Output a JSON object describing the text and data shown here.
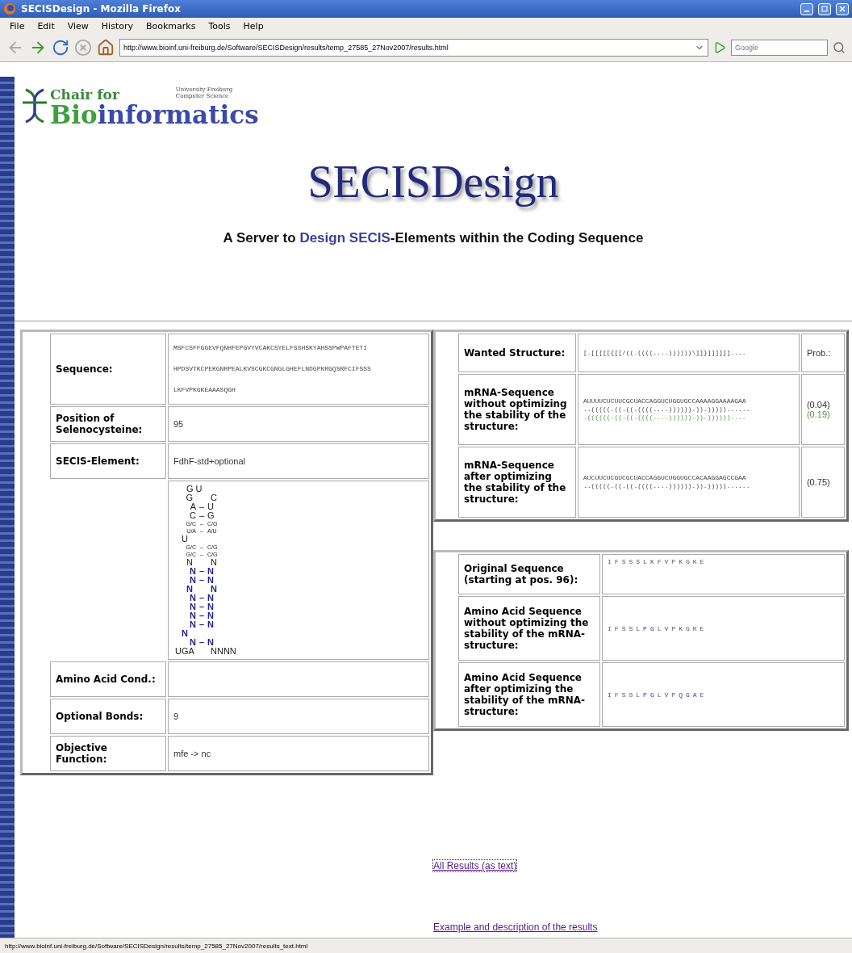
{
  "window": {
    "title": "SECISDesign - Mozilla Firefox"
  },
  "menu": [
    "File",
    "Edit",
    "View",
    "History",
    "Bookmarks",
    "Tools",
    "Help"
  ],
  "toolbar": {
    "url": "http://www.bioinf.uni-freiburg.de/Software/SECISDesign/results/temp_27585_27Nov2007/results.html",
    "search_placeholder": "Google"
  },
  "logo": {
    "chair_for": "Chair for",
    "bio": "Bio",
    "informatics": "informatics",
    "university": "University Freiburg",
    "department": "Computer Science"
  },
  "title": "SECISDesign",
  "subtitle": [
    {
      "text": "A Server to ",
      "highlight": false
    },
    {
      "text": "Design SECIS",
      "highlight": true
    },
    {
      "text": "-Elements within the Coding Sequence",
      "highlight": false
    }
  ],
  "parameters": [
    {
      "kind": "sequence",
      "label": "Sequence:",
      "lines": [
        "MSFCSFFGGEVFQNHFEPGVYVCAKCSYELFSSHSKYAHSSPWPAFTETI",
        "HPDSVTKCPEKGNRPEALKVSCGKCGNGLGHEFLNDGPKRGQSRFCIFSSS",
        "LKFVPKGKEAAASQGH"
      ]
    },
    {
      "kind": "text",
      "label": "Position of Selenocysteine:",
      "value": "95"
    },
    {
      "kind": "text",
      "label": "SECIS-Element:",
      "value": "FdhF-std+optional"
    },
    {
      "kind": "structure",
      "rows": [
        {
          "kind": "loop",
          "text": "G U",
          "variable": false,
          "small": false
        },
        {
          "kind": "open",
          "left": "G",
          "right": "C",
          "variable": false,
          "small": false
        },
        {
          "kind": "pair",
          "left": "A",
          "bond": "–",
          "right": "U",
          "variable": false,
          "small": false
        },
        {
          "kind": "pair",
          "left": "C",
          "bond": "–",
          "right": "G",
          "variable": false,
          "small": false
        },
        {
          "kind": "pair",
          "left": "G/C",
          "bond": "–",
          "right": "C/G",
          "variable": false,
          "small": true
        },
        {
          "kind": "pair",
          "left": "U/A",
          "bond": "–",
          "right": "A/U",
          "variable": false,
          "small": true
        },
        {
          "kind": "bulge",
          "left": "U",
          "variable": false,
          "small": false
        },
        {
          "kind": "pair",
          "left": "G/C",
          "bond": "–",
          "right": "C/G",
          "variable": false,
          "small": true
        },
        {
          "kind": "pair",
          "left": "G/C",
          "bond": "–",
          "right": "C/G",
          "variable": false,
          "small": true
        },
        {
          "kind": "open",
          "left": "N",
          "right": "N",
          "variable": false,
          "small": false
        },
        {
          "kind": "pair",
          "left": "N",
          "bond": "–",
          "right": "N",
          "variable": true,
          "small": false
        },
        {
          "kind": "pair",
          "left": "N",
          "bond": "–",
          "right": "N",
          "variable": true,
          "small": false
        },
        {
          "kind": "open",
          "left": "N",
          "right": "N",
          "variable": true,
          "small": false
        },
        {
          "kind": "pair",
          "left": "N",
          "bond": "–",
          "right": "N",
          "variable": true,
          "small": false
        },
        {
          "kind": "pair",
          "left": "N",
          "bond": "–",
          "right": "N",
          "variable": true,
          "small": false
        },
        {
          "kind": "pair",
          "left": "N",
          "bond": "–",
          "right": "N",
          "variable": true,
          "small": false
        },
        {
          "kind": "pair",
          "left": "N",
          "bond": "–",
          "right": "N",
          "variable": true,
          "small": false
        },
        {
          "kind": "bulge",
          "left": "N",
          "variable": true,
          "small": false
        },
        {
          "kind": "pair",
          "left": "N",
          "bond": "–",
          "right": "N",
          "variable": true,
          "small": false
        },
        {
          "kind": "open",
          "left": "UGA",
          "right": "NNNN",
          "variable": false,
          "small": false
        }
      ]
    },
    {
      "kind": "text",
      "label": "Amino Acid Cond.:"
    },
    {
      "kind": "text",
      "label": "Optional Bonds:",
      "value": "9"
    },
    {
      "kind": "text",
      "label": "Objective Function:",
      "value": "mfe -> nc"
    }
  ],
  "structures": [
    {
      "label": "Wanted Structure:",
      "lines": [
        {
          "text": "[.[[[[[{[[/((.((((....))))))\\]]}]]]]]]....",
          "alternative": false
        }
      ],
      "probs": [
        {
          "text": "Prob.:",
          "alternative": false
        }
      ]
    },
    {
      "label": "mRNA-Sequence without optimizing the stability of the structure:",
      "lines": [
        {
          "text": "AUUUUCUCUUCGCUACCAGGUCUGGUGCCAAAAGGAAAAGAA",
          "alternative": false
        },
        {
          "text": "..(((((.((.((.((((....)))))).)).)))))......",
          "alternative": false
        },
        {
          "text": ".((((((.((.((.((((....)))))).)).))))))....",
          "alternative": true
        }
      ],
      "probs": [
        {
          "text": "(0.04)",
          "alternative": false
        },
        {
          "text": "(0.19)",
          "alternative": true
        }
      ]
    },
    {
      "label": "mRNA-Sequence after optimizing the stability of the structure:",
      "lines": [
        {
          "text": "AUCUUCUCGUCGCUACCAGGUCUGGUGCCACAAGGAGCCGAA",
          "alternative": false
        },
        {
          "text": "..(((((.((.((.((((....)))))).)).)))))......",
          "alternative": false
        }
      ],
      "probs": [
        {
          "text": "(0.75)",
          "alternative": false
        }
      ]
    }
  ],
  "amino_acids": [
    {
      "label": "Original Sequence (starting at pos. 96):",
      "residues": [
        {
          "aa": "I",
          "changed": false
        },
        {
          "aa": "F",
          "changed": false
        },
        {
          "aa": "S",
          "changed": false
        },
        {
          "aa": "S",
          "changed": false
        },
        {
          "aa": "S",
          "changed": false
        },
        {
          "aa": "L",
          "changed": false
        },
        {
          "aa": "K",
          "changed": false
        },
        {
          "aa": "F",
          "changed": false
        },
        {
          "aa": "V",
          "changed": false
        },
        {
          "aa": "P",
          "changed": false
        },
        {
          "aa": "K",
          "changed": false
        },
        {
          "aa": "G",
          "changed": false
        },
        {
          "aa": "K",
          "changed": false
        },
        {
          "aa": "E",
          "changed": false
        }
      ]
    },
    {
      "label": "Amino Acid Sequence without optimizing the stability of the mRNA-structure:",
      "residues": [
        {
          "aa": "I",
          "changed": false
        },
        {
          "aa": "F",
          "changed": false
        },
        {
          "aa": "S",
          "changed": false
        },
        {
          "aa": "S",
          "changed": false
        },
        {
          "aa": "L",
          "changed": false
        },
        {
          "aa": "P",
          "changed": true
        },
        {
          "aa": "G",
          "changed": true
        },
        {
          "aa": "L",
          "changed": false
        },
        {
          "aa": "V",
          "changed": false
        },
        {
          "aa": "P",
          "changed": false
        },
        {
          "aa": "K",
          "changed": false
        },
        {
          "aa": "G",
          "changed": false
        },
        {
          "aa": "K",
          "changed": false
        },
        {
          "aa": "E",
          "changed": false
        }
      ]
    },
    {
      "label": "Amino Acid Sequence after optimizing the stability of the mRNA-structure:",
      "residues": [
        {
          "aa": "I",
          "changed": false
        },
        {
          "aa": "F",
          "changed": false
        },
        {
          "aa": "S",
          "changed": false
        },
        {
          "aa": "S",
          "changed": false
        },
        {
          "aa": "L",
          "changed": false
        },
        {
          "aa": "P",
          "changed": true
        },
        {
          "aa": "G",
          "changed": true
        },
        {
          "aa": "L",
          "changed": false
        },
        {
          "aa": "V",
          "changed": false
        },
        {
          "aa": "P",
          "changed": false
        },
        {
          "aa": "Q",
          "changed": true
        },
        {
          "aa": "G",
          "changed": true
        },
        {
          "aa": "A",
          "changed": true
        },
        {
          "aa": "E",
          "changed": false
        }
      ]
    }
  ],
  "links": [
    {
      "text": "All Results (as text)",
      "focused": true
    },
    {
      "text": "Example and description of the results",
      "focused": false
    }
  ],
  "status_bar": "http://www.bioinf.uni-freiburg.de/Software/SECISDesign/results/temp_27585_27Nov2007/results_text.html"
}
